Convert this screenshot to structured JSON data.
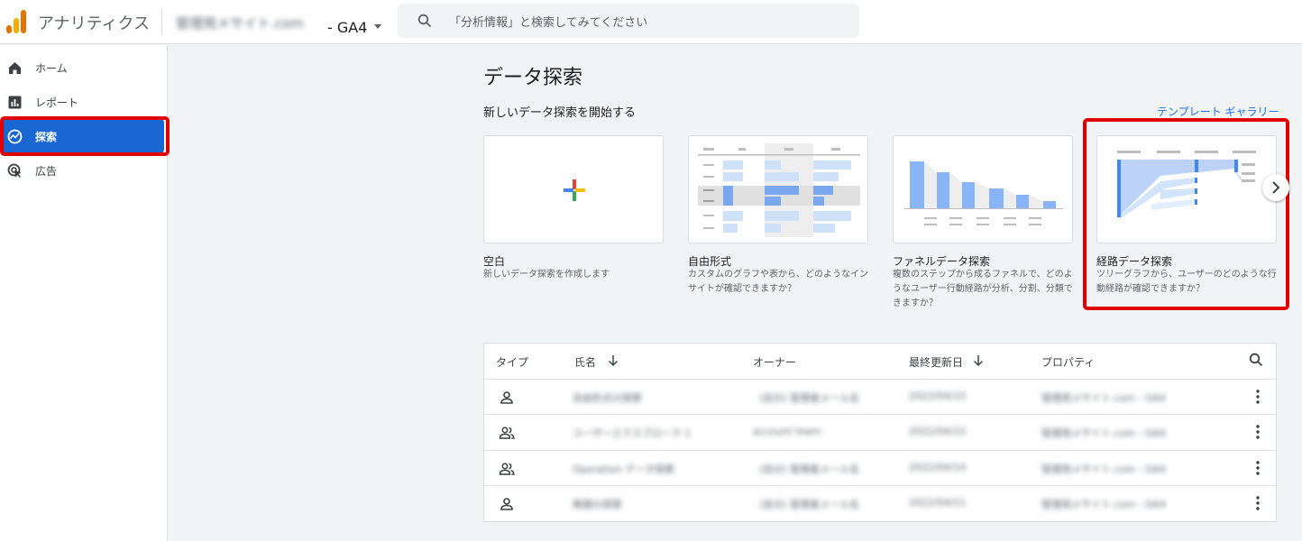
{
  "header": {
    "app_title": "アナリティクス",
    "account_name": "管理用メサイト.com",
    "property": "- GA4",
    "search_placeholder": "「分析情報」と検索してみてください"
  },
  "sidebar": {
    "items": [
      {
        "label": "ホーム",
        "icon": "home-icon"
      },
      {
        "label": "レポート",
        "icon": "reports-icon"
      },
      {
        "label": "探索",
        "icon": "explore-icon",
        "active": true
      },
      {
        "label": "広告",
        "icon": "advertising-icon"
      }
    ]
  },
  "main": {
    "title": "データ探索",
    "subtitle": "新しいデータ探索を開始する",
    "gallery_link": "テンプレート ギャラリー",
    "cards": [
      {
        "title": "空白",
        "desc_lines": [
          "新しいデータ探索を作成します"
        ]
      },
      {
        "title": "自由形式",
        "desc_lines": [
          "カスタムのグラフや表から、どのようなイン",
          "サイトが確認できますか？"
        ]
      },
      {
        "title": "ファネルデータ探索",
        "desc_lines": [
          "複数のステップから成るファネルで、どのよ",
          "うなユーザー行動経路が分析、分割、分類で",
          "きますか？"
        ]
      },
      {
        "title": "経路データ探索",
        "desc_lines": [
          "ツリーグラフから、ユーザーのどのような行",
          "動経路が確認できますか？"
        ]
      }
    ]
  },
  "table": {
    "headers": {
      "type": "タイプ",
      "name": "氏名",
      "owner": "オーナー",
      "updated": "最終更新日",
      "property": "プロパティ"
    },
    "rows": [
      {
        "type_icon": "person-icon",
        "name": "自由形式の探索",
        "owner": "(自分) 管理者メール名",
        "updated": "2022/04/15",
        "property": "管理用メサイト.com - GA4"
      },
      {
        "type_icon": "group-icon",
        "name": "ユーザーエクスプローラ 1",
        "owner": "account team",
        "updated": "2022/04/15",
        "property": "管理用メサイト.com - GA4"
      },
      {
        "type_icon": "group-icon",
        "name": "Operation データ探索",
        "owner": "(自分) 管理者メール名",
        "updated": "2022/04/14",
        "property": "管理用メサイト.com - GA4"
      },
      {
        "type_icon": "person-icon",
        "name": "無題の探索",
        "owner": "(自分) 管理者メール名",
        "updated": "2022/04/11",
        "property": "管理用メサイト.com - GA4"
      }
    ]
  },
  "colors": {
    "accent": "#1967d2",
    "highlight": "#e00000",
    "link": "#1a73e8"
  }
}
